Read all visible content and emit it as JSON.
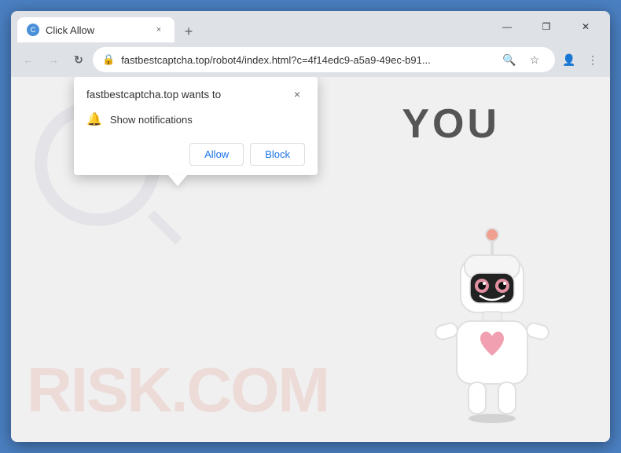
{
  "browser": {
    "tab": {
      "favicon_label": "C",
      "title": "Click Allow",
      "close_label": "×"
    },
    "new_tab_label": "+",
    "window_controls": {
      "minimize": "—",
      "maximize": "❐",
      "close": "✕"
    },
    "nav": {
      "back": "←",
      "forward": "→",
      "refresh": "↻"
    },
    "url": {
      "lock": "🔒",
      "text": "fastbestcaptcha.top/robot4/index.html?c=4f14edc9-a5a9-49ec-b91..."
    },
    "toolbar": {
      "search": "🔍",
      "star": "☆",
      "profile": "👤",
      "menu": "⋮",
      "download": "⬇"
    }
  },
  "popup": {
    "title": "fastbestcaptcha.top wants to",
    "close": "×",
    "notification_icon": "🔔",
    "notification_text": "Show notifications",
    "allow_label": "Allow",
    "block_label": "Block"
  },
  "page": {
    "you_text": "YOU",
    "watermark": "RISK.COM",
    "robot_alt": "cute robot illustration"
  }
}
